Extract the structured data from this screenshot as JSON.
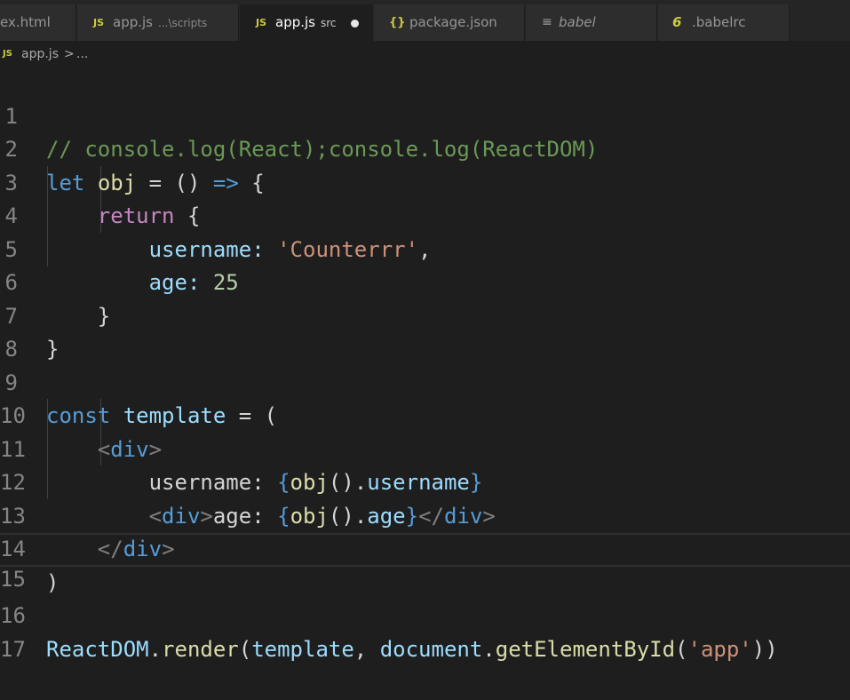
{
  "tabs": [
    {
      "icon": "",
      "label": "ex.html",
      "description": ""
    },
    {
      "icon": "JS",
      "label": "app.js",
      "description": "...\\scripts"
    },
    {
      "icon": "JS",
      "label": "app.js",
      "description": "src",
      "active": true,
      "modified": true
    },
    {
      "icon": "{}",
      "label": "package.json",
      "description": ""
    },
    {
      "icon": "≡",
      "label": "babel",
      "description": ""
    },
    {
      "icon": "6",
      "label": ".babelrc",
      "description": ""
    }
  ],
  "breadcrumb": {
    "icon": "JS",
    "file": "app.js",
    "separator": ">",
    "rest": "..."
  },
  "line_numbers": [
    "1",
    "2",
    "3",
    "4",
    "5",
    "6",
    "7",
    "8",
    "9",
    "10",
    "11",
    "12",
    "13",
    "14",
    "15",
    "16",
    "17"
  ],
  "code": {
    "l1": {
      "comment": "// console.log(React);console.log(ReactDOM)"
    },
    "l2": {
      "kw": "let",
      "name": "obj",
      "eq": "=",
      "parens": "()",
      "arrow": "=>",
      "brace": "{"
    },
    "l3": {
      "kw": "return",
      "brace": "{"
    },
    "l4": {
      "prop": "username",
      "colon": ":",
      "str": "'Counterrr'",
      "comma": ","
    },
    "l5": {
      "prop": "age",
      "colon": ":",
      "num": "25"
    },
    "l6": {
      "brace": "}"
    },
    "l7": {
      "brace": "}"
    },
    "l9": {
      "kw": "const",
      "name": "template",
      "eq": "=",
      "paren": "("
    },
    "l10": {
      "lt": "<",
      "tag": "div",
      "gt": ">"
    },
    "l11": {
      "text": "username: ",
      "ob": "{",
      "fn": "obj",
      "call": "().",
      "prop": "username",
      "cb": "}"
    },
    "l12": {
      "lt": "<",
      "tag": "div",
      "gt": ">",
      "text": "age: ",
      "ob": "{",
      "fn": "obj",
      "call": "().",
      "prop": "age",
      "cb": "}",
      "lt2": "</",
      "tag2": "div",
      "gt2": ">"
    },
    "l13": {
      "lt": "</",
      "tag": "div",
      "gt": ">"
    },
    "l14": {
      "paren": ")"
    },
    "l16": {
      "obj": "ReactDOM",
      "dot": ".",
      "fn": "render",
      "op": "(",
      "arg1": "template",
      "comma": ", ",
      "obj2": "document",
      "dot2": ".",
      "fn2": "getElementById",
      "op2": "(",
      "str": "'app'",
      "cp": "))"
    }
  },
  "colors": {
    "editor_bg": "#1e1e1e",
    "tab_bg": "#2d2d2d",
    "js_icon": "#cbcb41",
    "json_icon": "#cbcb41",
    "comment": "#6a9955",
    "keyword": "#569cd6"
  }
}
